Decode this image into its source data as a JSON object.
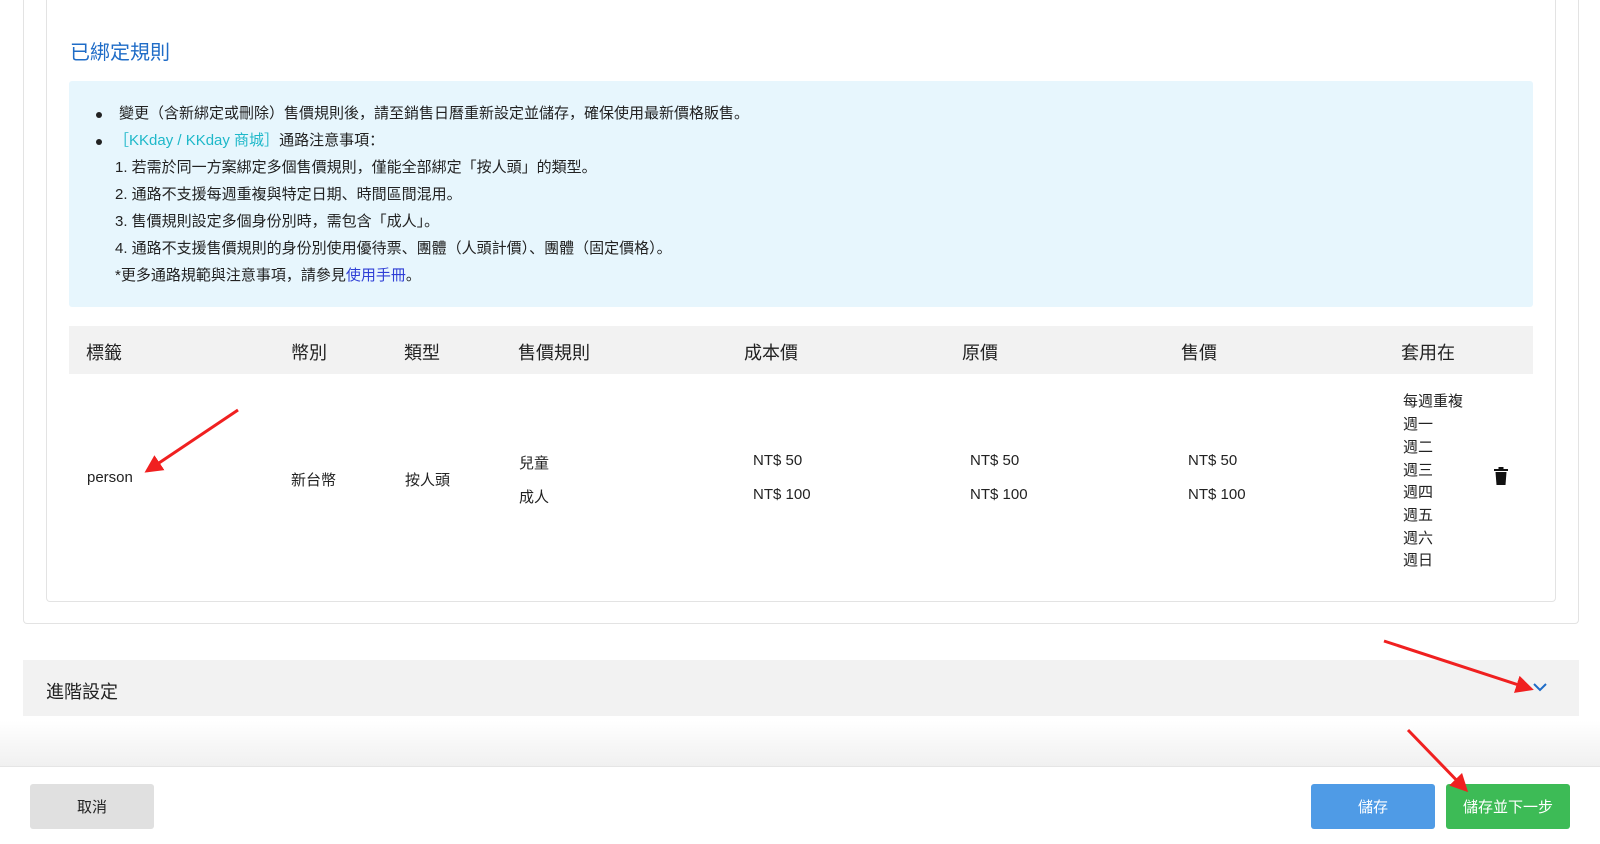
{
  "section": {
    "title": "已綁定規則"
  },
  "notice": {
    "line1": "變更（含新綁定或刪除）售價規則後，請至銷售日曆重新設定並儲存，確保使用最新價格販售。",
    "line2_tag": "［KKday / KKday 商城］",
    "line2_rest": "通路注意事項：",
    "items": [
      "1. 若需於同一方案綁定多個售價規則，僅能全部綁定「按人頭」的類型。",
      "2. 通路不支援每週重複與特定日期、時間區間混用。",
      "3. 售價規則設定多個身份別時，需包含「成人」。",
      "4. 通路不支援售價規則的身份別使用優待票、團體（人頭計價）、團體（固定價格）。"
    ],
    "footnote_prefix": "*更多通路規範與注意事項，請參見",
    "footnote_link": "使用手冊",
    "footnote_suffix": "。"
  },
  "table": {
    "headers": {
      "tag": "標籤",
      "currency": "幣別",
      "type": "類型",
      "rule": "售價規則",
      "cost": "成本價",
      "original": "原價",
      "price": "售價",
      "apply": "套用在"
    },
    "row": {
      "tag": "person",
      "currency": "新台幣",
      "type": "按人頭",
      "identities": [
        "兒童",
        "成人"
      ],
      "cost": [
        "NT$ 50",
        "NT$ 100"
      ],
      "original": [
        "NT$ 50",
        "NT$ 100"
      ],
      "price": [
        "NT$ 50",
        "NT$ 100"
      ],
      "apply": [
        "每週重複",
        "週一",
        "週二",
        "週三",
        "週四",
        "週五",
        "週六",
        "週日"
      ]
    }
  },
  "advanced": {
    "label": "進階設定"
  },
  "footer": {
    "cancel": "取消",
    "save": "儲存",
    "save_next": "儲存並下一步"
  },
  "colors": {
    "title_blue": "#1f6cc7",
    "notice_bg": "#e7f6fd",
    "kkday_tag": "#1eb8c9",
    "save_blue": "#4f9be6",
    "next_green": "#3dbb56",
    "annotation_red": "#f02020"
  },
  "icons": [
    "trash-icon",
    "chevron-down-icon",
    "annotation-arrow"
  ]
}
